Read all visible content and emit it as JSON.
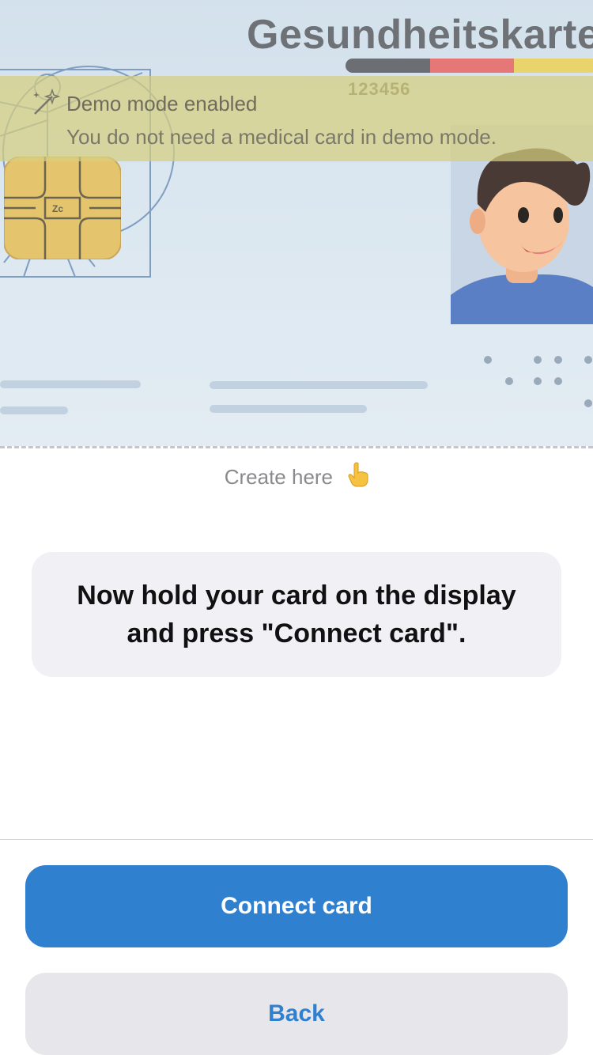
{
  "card": {
    "title": "Gesundheitskarte",
    "number": "123456",
    "chip_mark": "Zc"
  },
  "demo_banner": {
    "title": "Demo mode enabled",
    "text": "You do not need a medical card in demo mode."
  },
  "create_hint": {
    "label": "Create here",
    "icon": "pointing-hand-icon"
  },
  "instruction": {
    "text": "Now hold your card on the display and press \"Connect card\"."
  },
  "actions": {
    "connect_label": "Connect card",
    "back_label": "Back"
  },
  "colors": {
    "accent": "#2f81d0",
    "secondary_button": "#e6e6eb",
    "instruction_bg": "#f0f0f5",
    "demo_banner": "#d6ce80"
  }
}
